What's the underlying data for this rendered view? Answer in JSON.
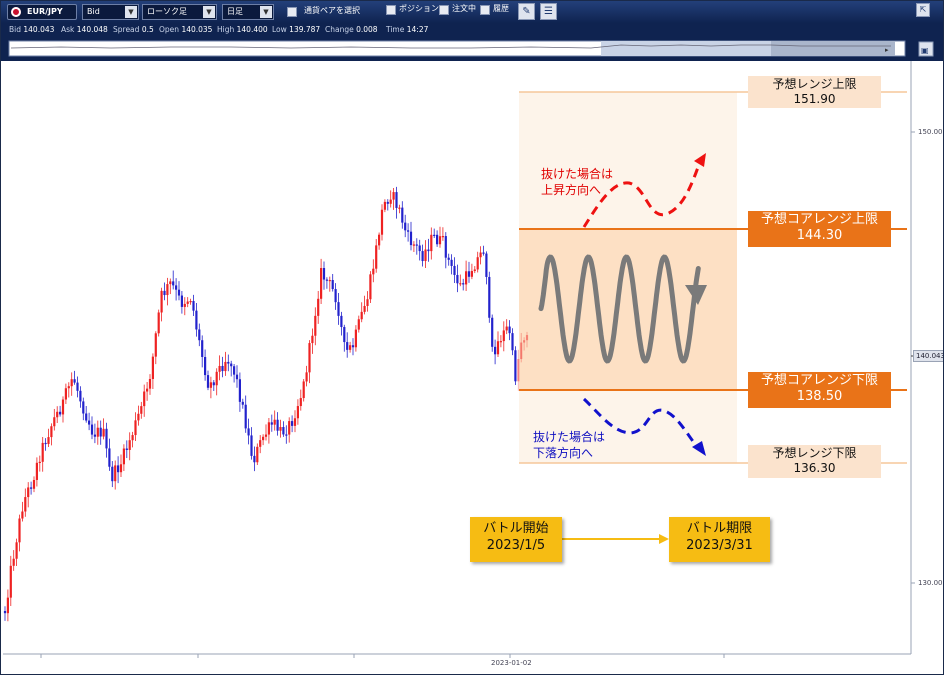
{
  "toolbar": {
    "pair": "EUR/JPY",
    "price_type": "Bid",
    "chart_type": "ローソク足",
    "period": "日足",
    "select_pair_label": "通貨ペアを選択",
    "position_label": "ポジション",
    "order_label": "注文中",
    "history_label": "履歴"
  },
  "infobar": {
    "bid_label": "Bid",
    "bid": "140.043",
    "ask_label": "Ask",
    "ask": "140.048",
    "spread_label": "Spread",
    "spread": "0.5",
    "open_label": "Open",
    "open": "140.035",
    "high_label": "High",
    "high": "140.400",
    "low_label": "Low",
    "low": "139.787",
    "change_label": "Change",
    "change": "0.008",
    "time_label": "Time",
    "time": "14:27"
  },
  "axis": {
    "y_top": "150.000",
    "y_bottom": "130.000",
    "current_price": "140.043",
    "x_date": "2023-01-02"
  },
  "annotations": {
    "range_upper": {
      "label": "予想レンジ上限",
      "value": "151.90"
    },
    "core_upper": {
      "label": "予想コアレンジ上限",
      "value": "144.30"
    },
    "core_lower": {
      "label": "予想コアレンジ下限",
      "value": "138.50"
    },
    "range_lower": {
      "label": "予想レンジ下限",
      "value": "136.30"
    },
    "breakout_up": {
      "line1": "抜けた場合は",
      "line2": "上昇方向へ"
    },
    "breakout_down": {
      "line1": "抜けた場合は",
      "line2": "下落方向へ"
    },
    "battle_start": {
      "label": "バトル開始",
      "date": "2023/1/5"
    },
    "battle_end": {
      "label": "バトル期限",
      "date": "2023/3/31"
    }
  },
  "colors": {
    "toolbar_bg": "#0f2350",
    "bull_candle": "#ee2222",
    "bear_candle": "#2222cc",
    "range_band": "#fdf4ea",
    "core_band": "#fde0c4",
    "core_line": "#e97318",
    "range_line": "#f5c79a",
    "callout_peach": "#fbe3cd",
    "callout_orange": "#e97318",
    "callout_yellow": "#f6bc13",
    "up_arrow": "#ee1111",
    "down_arrow": "#1111cc"
  },
  "chart_data": {
    "type": "candlestick",
    "ylim": [
      127.5,
      152.5
    ],
    "current": 140.043
  }
}
